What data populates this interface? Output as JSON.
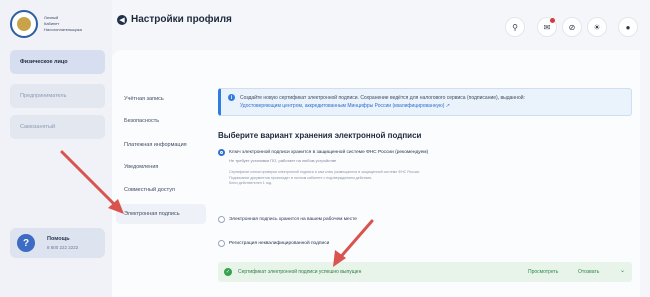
{
  "logo": {
    "text_lines": [
      "Личный",
      "Кабинет",
      "Налогоплательщика"
    ]
  },
  "sidebar": {
    "items": [
      {
        "label": "Физическое лицо"
      },
      {
        "label": "Предприниматель"
      },
      {
        "label": "Самозанятый"
      }
    ],
    "help": {
      "title": "Помощь",
      "phone": "8 800 222 2222"
    }
  },
  "header": {
    "title": "Настройки профиля",
    "icons": [
      "search-icon",
      "mail-icon",
      "eye-off-icon",
      "lightbulb-icon",
      "user-icon"
    ]
  },
  "menu": {
    "items": [
      {
        "label": "Учётная запись"
      },
      {
        "label": "Безопасность"
      },
      {
        "label": "Платежная информация"
      },
      {
        "label": "Уведомления"
      },
      {
        "label": "Совместный доступ"
      },
      {
        "label": "Электронная подпись"
      }
    ]
  },
  "info": {
    "text": "Создайте новую сертификат электронной подписи. Сохранение ведётся для налогового сервиса (подписание), выданной:",
    "link": "Удостоверяющим центром, аккредитованным Минцифры России (квалифицированную)"
  },
  "section": {
    "title": "Выберите вариант хранения электронной подписи",
    "options": [
      {
        "label": "Ключ электронной подписи хранится в защищенной системе ФНС России (рекомендуем)",
        "sub": "Не требует установки ПО, работает на любом устройстве",
        "fine": [
          "Сертификат ключа проверки электронной подписи и сам ключ размещаются в защищенной системе ФНС России.",
          "Подписание документов происходит в личном кабинете с подтверждением действия.",
          "Ключ действителен 1 год."
        ]
      },
      {
        "label": "Электронная подпись хранится на вашем рабочем месте"
      },
      {
        "label": "Регистрация неквалифицированной подписи"
      }
    ]
  },
  "success": {
    "text": "Сертификат электронной подписи успешно выпущен",
    "view": "Просмотреть",
    "revoke": "Отозвать"
  },
  "colors": {
    "accent": "#2f6fd0",
    "success": "#35a24f",
    "arrow": "#d9534f"
  }
}
